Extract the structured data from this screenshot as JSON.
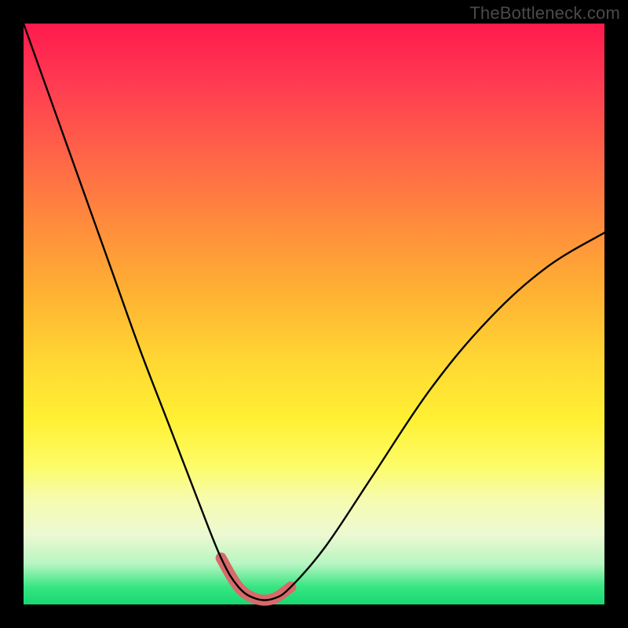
{
  "watermark": "TheBottleneck.com",
  "colors": {
    "frame": "#000000",
    "curve": "#000000",
    "highlight": "#d86a6a",
    "gradient_top": "#ff1a4d",
    "gradient_bottom": "#18d873"
  },
  "chart_data": {
    "type": "line",
    "title": "",
    "xlabel": "",
    "ylabel": "",
    "xlim": [
      0,
      1
    ],
    "ylim": [
      0,
      1
    ],
    "grid": false,
    "legend": false,
    "series": [
      {
        "name": "bottleneck-curve",
        "x": [
          0.0,
          0.05,
          0.1,
          0.15,
          0.2,
          0.25,
          0.3,
          0.34,
          0.37,
          0.4,
          0.43,
          0.46,
          0.52,
          0.6,
          0.7,
          0.8,
          0.9,
          1.0
        ],
        "y": [
          1.0,
          0.86,
          0.72,
          0.58,
          0.44,
          0.31,
          0.18,
          0.08,
          0.03,
          0.01,
          0.01,
          0.03,
          0.1,
          0.22,
          0.37,
          0.49,
          0.58,
          0.64
        ]
      },
      {
        "name": "optimal-region",
        "x": [
          0.34,
          0.37,
          0.4,
          0.43,
          0.46
        ],
        "y": [
          0.08,
          0.03,
          0.01,
          0.01,
          0.03
        ]
      }
    ],
    "annotations": []
  }
}
